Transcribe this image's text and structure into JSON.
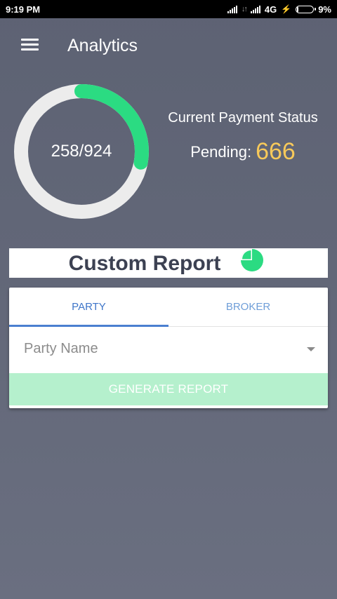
{
  "status_bar": {
    "time": "9:19 PM",
    "network": "4G",
    "battery": "9%",
    "battery_level": 0.09
  },
  "app_bar": {
    "title": "Analytics",
    "menu_icon": "hamburger-menu-icon"
  },
  "summary": {
    "progress_label": "258/924",
    "completed": 258,
    "total": 924,
    "payment_status_title": "Current Payment Status",
    "pending_label": "Pending:",
    "pending_value": "666"
  },
  "custom_report": {
    "title": "Custom Report",
    "icon": "pie-chart-icon",
    "tabs": [
      {
        "label": "PARTY",
        "active": true
      },
      {
        "label": "BROKER",
        "active": false
      }
    ],
    "party_select": {
      "placeholder": "Party Name"
    },
    "generate_label": "GENERATE REPORT"
  },
  "colors": {
    "ring_progress": "#2bdb82",
    "ring_track": "#ececec",
    "pending_value": "#f7c95a",
    "tab_active": "#3f76c9",
    "button_bg": "#b5f0cd"
  }
}
